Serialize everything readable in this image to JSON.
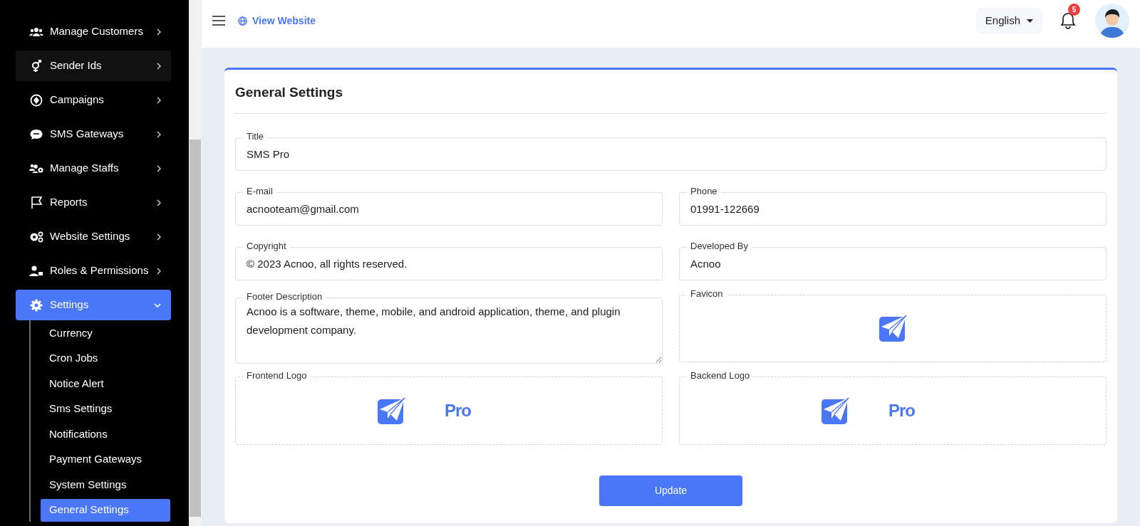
{
  "sidebar": {
    "items": [
      {
        "label": "Manage Customers",
        "selected": false,
        "hovered": false
      },
      {
        "label": "Sender Ids",
        "selected": false,
        "hovered": true
      },
      {
        "label": "Campaigns",
        "selected": false,
        "hovered": false
      },
      {
        "label": "SMS Gateways",
        "selected": false,
        "hovered": false
      },
      {
        "label": "Manage Staffs",
        "selected": false,
        "hovered": false
      },
      {
        "label": "Reports",
        "selected": false,
        "hovered": false
      },
      {
        "label": "Website Settings",
        "selected": false,
        "hovered": false
      },
      {
        "label": "Roles & Permissions",
        "selected": false,
        "hovered": false
      },
      {
        "label": "Settings",
        "selected": true,
        "expanded": true,
        "children": [
          {
            "label": "Currency",
            "selected": false
          },
          {
            "label": "Cron Jobs",
            "selected": false
          },
          {
            "label": "Notice Alert",
            "selected": false
          },
          {
            "label": "Sms Settings",
            "selected": false
          },
          {
            "label": "Notifications",
            "selected": false
          },
          {
            "label": "Payment Gateways",
            "selected": false
          },
          {
            "label": "System Settings",
            "selected": false
          },
          {
            "label": "General Settings",
            "selected": true
          }
        ]
      }
    ]
  },
  "header": {
    "link": "View Website",
    "language": "English",
    "notifications": "5"
  },
  "form": {
    "title": "General Settings",
    "fields": [
      {
        "kind": "text",
        "label": "Title",
        "value": "SMS Pro",
        "wide": true
      },
      {
        "kind": "text",
        "label": "E-mail",
        "value": "acnooteam@gmail.com",
        "wide": false
      },
      {
        "kind": "text",
        "label": "Phone",
        "value": "01991-122669",
        "wide": false
      },
      {
        "kind": "text",
        "label": "Copyright",
        "value": "© 2023 Acnoo, all rights reserved.",
        "wide": false
      },
      {
        "kind": "text",
        "label": "Developed By",
        "value": "Acnoo",
        "wide": false
      },
      {
        "kind": "textarea",
        "label": "Footer Description",
        "value": "Acnoo is a software, theme, mobile, and android application, theme, and plugin development company.",
        "wide": false
      },
      {
        "kind": "image",
        "label": "Favicon",
        "wide": false
      },
      {
        "kind": "logo",
        "label": "Frontend Logo",
        "logo_text": "Pro",
        "wide": false
      },
      {
        "kind": "logo",
        "label": "Backend Logo",
        "logo_text": "Pro",
        "wide": false
      }
    ],
    "button": "Update"
  }
}
